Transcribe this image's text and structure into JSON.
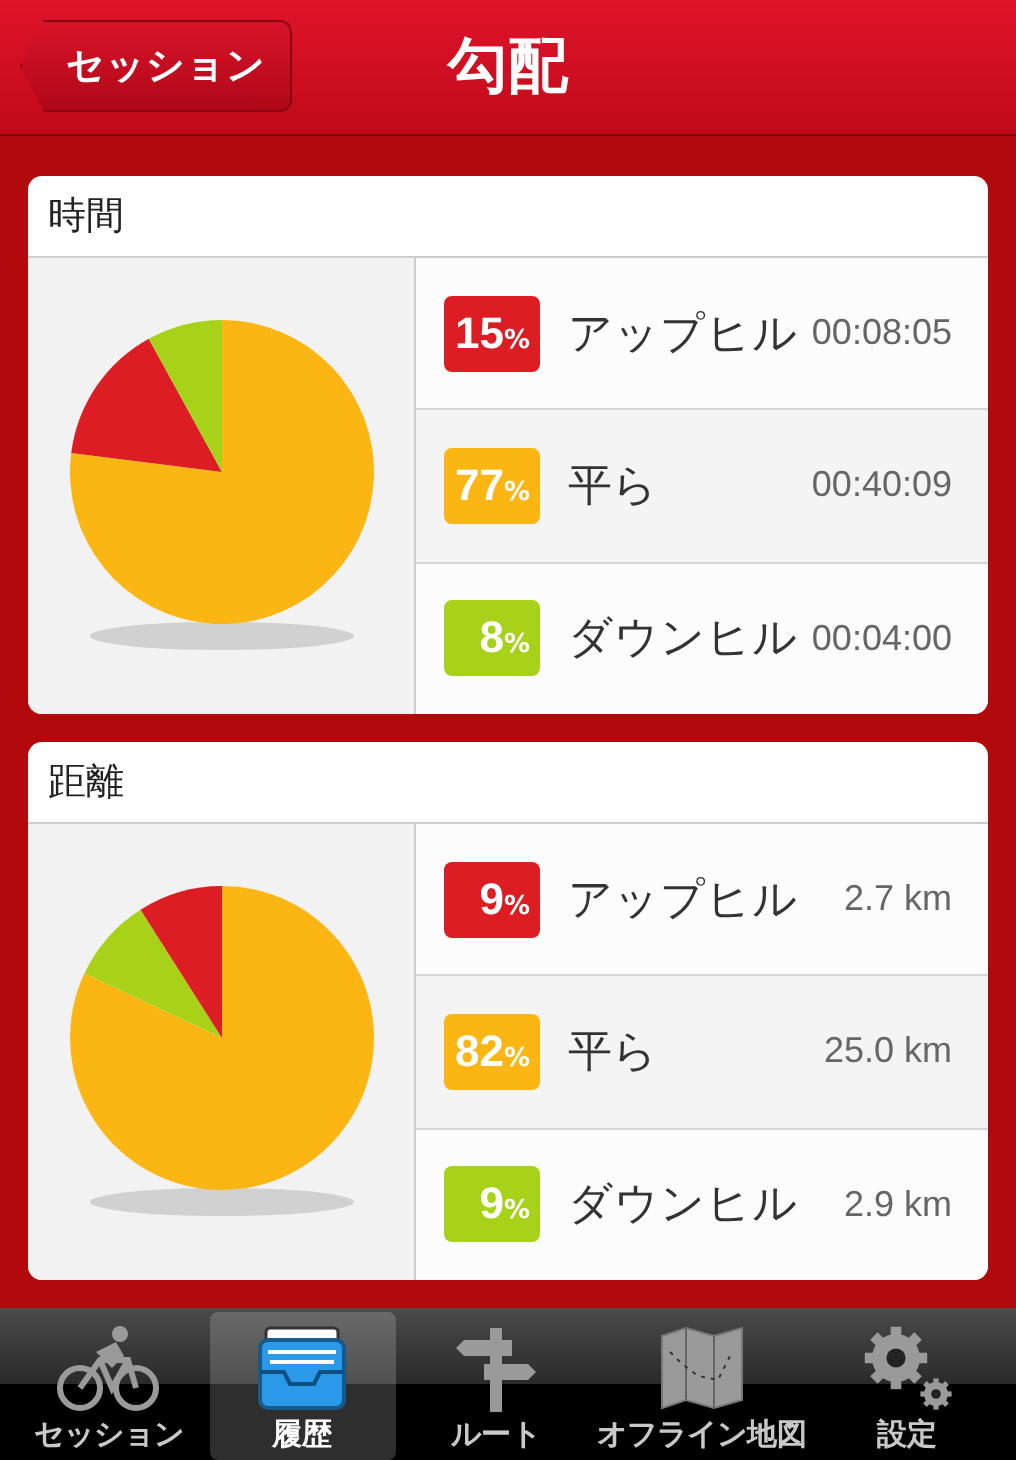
{
  "nav_bar": {
    "back_button": "セッション",
    "title": "勾配"
  },
  "sections": [
    {
      "title": "時間",
      "chart_data": {
        "type": "pie",
        "values": [
          77,
          15,
          8
        ],
        "colors": [
          "#fbb614",
          "#dc1e24",
          "#a8d21a"
        ]
      },
      "rows": [
        {
          "percent": "15",
          "unit": "%",
          "label": "アップヒル",
          "value": "00:08:05",
          "color": "#dc1e24"
        },
        {
          "percent": "77",
          "unit": "%",
          "label": "平ら",
          "value": "00:40:09",
          "color": "#fbb614"
        },
        {
          "percent": "8",
          "unit": "%",
          "label": "ダウンヒル",
          "value": "00:04:00",
          "color": "#a8d21a"
        }
      ]
    },
    {
      "title": "距離",
      "chart_data": {
        "type": "pie",
        "values": [
          82,
          9,
          9
        ],
        "colors": [
          "#fbb614",
          "#a8d21a",
          "#dc1e24"
        ]
      },
      "rows": [
        {
          "percent": "9",
          "unit": "%",
          "label": "アップヒル",
          "value": "2.7 km",
          "color": "#dc1e24"
        },
        {
          "percent": "82",
          "unit": "%",
          "label": "平ら",
          "value": "25.0 km",
          "color": "#fbb614"
        },
        {
          "percent": "9",
          "unit": "%",
          "label": "ダウンヒル",
          "value": "2.9 km",
          "color": "#a8d21a"
        }
      ]
    }
  ],
  "tab_bar": [
    {
      "kind": "bike",
      "label": "セッション",
      "selected": false
    },
    {
      "kind": "tray",
      "label": "履歴",
      "selected": true
    },
    {
      "kind": "sign",
      "label": "ルート",
      "selected": false
    },
    {
      "kind": "map",
      "label": "オフライン地図",
      "selected": false
    },
    {
      "kind": "gear",
      "label": "設定",
      "selected": false
    }
  ]
}
